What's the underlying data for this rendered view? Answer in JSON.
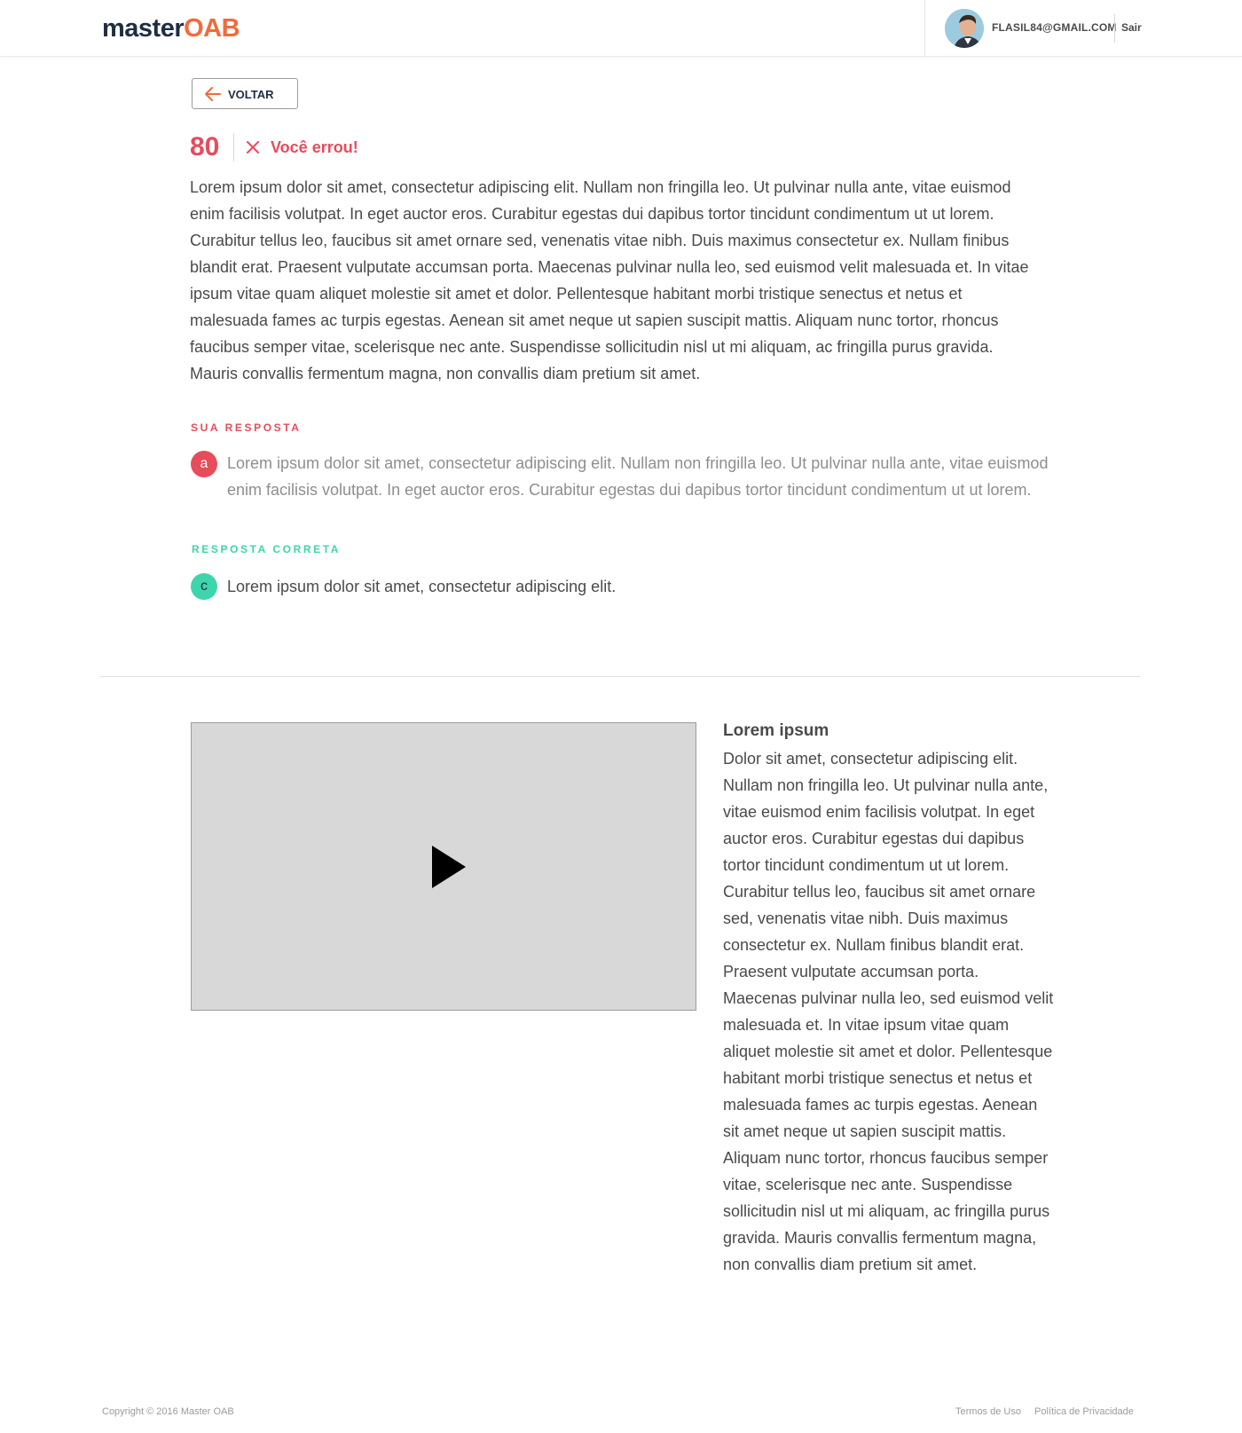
{
  "header": {
    "logo_part1": "master",
    "logo_part2": "OAB",
    "user_email": "FLASIL84@GMAIL.COM",
    "logout_label": "Sair"
  },
  "back_button": {
    "label": "VOLTAR",
    "icon": "arrow-left-icon"
  },
  "question": {
    "number": "80",
    "result_label": "Você errou!",
    "result_icon": "close-icon",
    "text": "Lorem ipsum dolor sit amet, consectetur adipiscing elit. Nullam non fringilla leo. Ut pulvinar nulla ante, vitae euismod enim facilisis volutpat. In eget auctor eros. Curabitur egestas dui dapibus tortor tincidunt condimentum ut ut lorem. Curabitur tellus leo, faucibus sit amet ornare sed, venenatis vitae nibh. Duis maximus consectetur ex. Nullam finibus blandit erat. Praesent vulputate accumsan porta. Maecenas pulvinar nulla leo, sed euismod velit malesuada et. In vitae ipsum vitae quam aliquet molestie sit amet et dolor. Pellentesque habitant morbi tristique senectus et netus et malesuada fames ac turpis egestas. Aenean sit amet neque ut sapien suscipit mattis. Aliquam nunc tortor, rhoncus faucibus semper vitae, scelerisque nec ante. Suspendisse sollicitudin nisl ut mi aliquam, ac fringilla purus gravida. Mauris convallis fermentum magna, non convallis diam pretium sit amet."
  },
  "your_answer": {
    "label": "SUA RESPOSTA",
    "letter": "a",
    "text": "Lorem ipsum dolor sit amet, consectetur adipiscing elit. Nullam non fringilla leo. Ut pulvinar nulla ante, vitae euismod enim facilisis volutpat. In eget auctor eros. Curabitur egestas dui dapibus tortor tincidunt condimentum ut ut lorem."
  },
  "correct_answer": {
    "label": "RESPOSTA CORRETA",
    "letter": "c",
    "text": "Lorem ipsum dolor sit amet, consectetur adipiscing elit."
  },
  "explanation": {
    "video_icon": "play-icon",
    "title": "Lorem ipsum",
    "body": "Dolor sit amet, consectetur adipiscing elit. Nullam non fringilla leo. Ut pulvinar nulla ante, vitae euismod enim facilisis volutpat. In eget auctor eros. Curabitur egestas dui dapibus tortor tincidunt condimentum ut ut lorem. Curabitur tellus leo, faucibus sit amet ornare sed, venenatis vitae nibh. Duis maximus consectetur ex. Nullam finibus blandit erat. Praesent vulputate accumsan porta. Maecenas pulvinar nulla leo, sed euismod velit malesuada et. In vitae ipsum vitae quam aliquet molestie sit amet et dolor. Pellentesque habitant morbi tristique senectus et netus et malesuada fames ac turpis egestas. Aenean sit amet neque ut sapien suscipit mattis. Aliquam nunc tortor, rhoncus faucibus semper vitae, scelerisque nec ante. Suspendisse sollicitudin nisl ut mi aliquam, ac fringilla purus gravida. Mauris convallis fermentum magna, non convallis diam pretium sit amet."
  },
  "footer": {
    "copyright": "Copyright © 2016 Master OAB",
    "terms_label": "Termos de Uso",
    "privacy_label": "Política de Privacidade"
  },
  "colors": {
    "brand_dark": "#1f2d42",
    "brand_orange": "#f26b3a",
    "error": "#e74c5b",
    "success": "#3fd5ac"
  }
}
